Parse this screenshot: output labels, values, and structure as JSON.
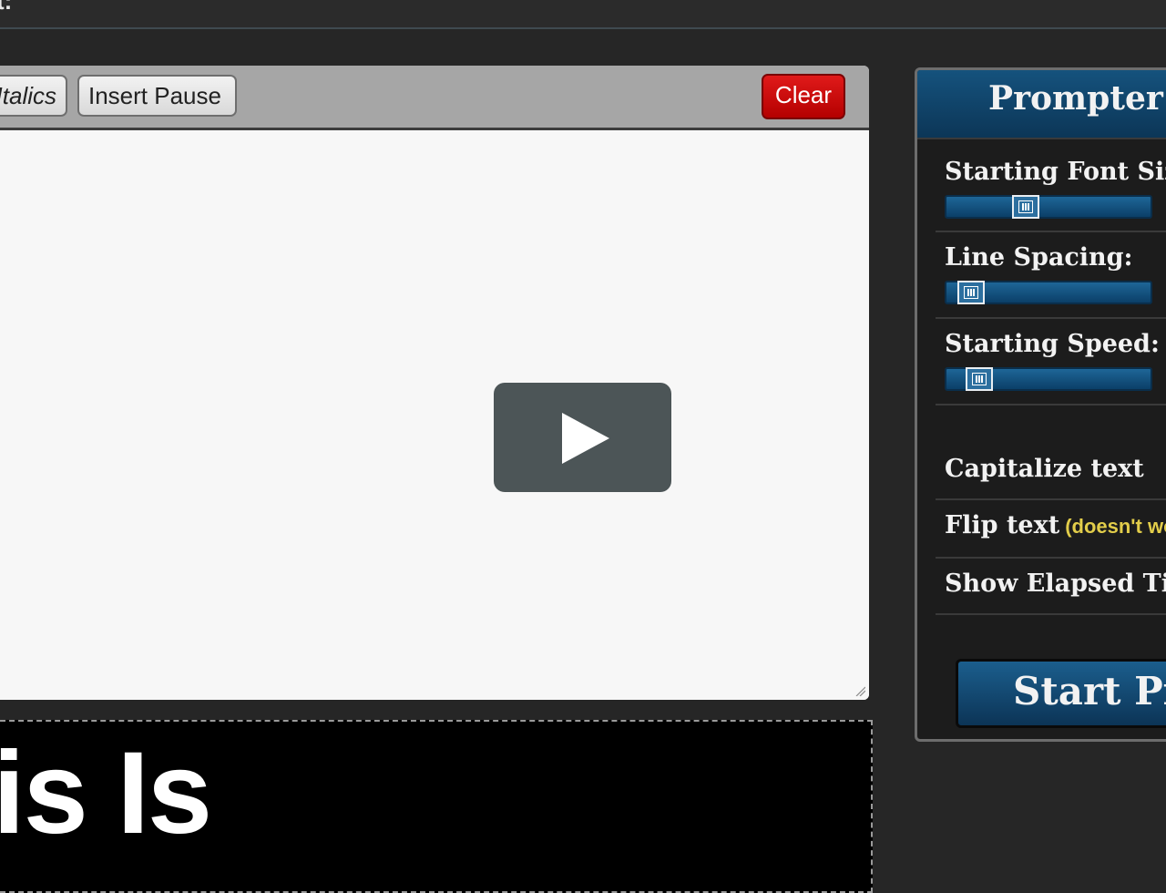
{
  "header": {
    "title_fragment": "t:"
  },
  "toolbar": {
    "italics_label": "Italics",
    "pause_label": "Insert Pause",
    "clear_label": "Clear"
  },
  "preview": {
    "text": "is Is"
  },
  "options": {
    "title": "Prompter options",
    "font_size": {
      "label": "Starting Font Size:",
      "value_fraction": 0.37
    },
    "line_spacing": {
      "label": "Line Spacing:",
      "value_fraction": 0.06
    },
    "speed": {
      "label": "Starting Speed:",
      "value_fraction": 0.11
    },
    "capitalize": {
      "label": "Capitalize text"
    },
    "flip": {
      "label": "Flip text",
      "note": "(doesn't work"
    },
    "elapsed": {
      "label": "Show Elapsed Time"
    },
    "start_label": "Start Prompter"
  },
  "colors": {
    "accent_blue": "#0f4a75",
    "clear_red": "#c40000",
    "note_yellow": "#e2cd4a"
  },
  "icons": {
    "play": "play-icon",
    "slider_grip": "grip-icon",
    "resize": "resize-grip-icon"
  }
}
